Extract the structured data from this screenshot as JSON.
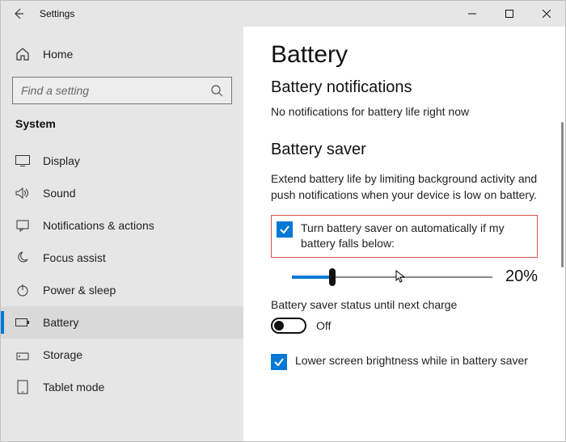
{
  "window": {
    "title": "Settings"
  },
  "sidebar": {
    "home": "Home",
    "search_placeholder": "Find a setting",
    "category": "System",
    "items": [
      {
        "label": "Display",
        "icon": "display-icon"
      },
      {
        "label": "Sound",
        "icon": "sound-icon"
      },
      {
        "label": "Notifications & actions",
        "icon": "notifications-icon"
      },
      {
        "label": "Focus assist",
        "icon": "focus-assist-icon"
      },
      {
        "label": "Power & sleep",
        "icon": "power-icon"
      },
      {
        "label": "Battery",
        "icon": "battery-icon",
        "selected": true
      },
      {
        "label": "Storage",
        "icon": "storage-icon"
      },
      {
        "label": "Tablet mode",
        "icon": "tablet-icon"
      }
    ]
  },
  "content": {
    "page_title": "Battery",
    "section_title": "Battery notifications",
    "empty_notice": "No notifications for battery life right now",
    "saver_title": "Battery saver",
    "saver_desc": "Extend battery life by limiting background activity and push notifications when your device is low on battery.",
    "auto_label": "Turn battery saver on automatically if my battery falls below:",
    "slider_percent": "20%",
    "slider_value": 20,
    "status_label": "Battery saver status until next charge",
    "toggle_state": "Off",
    "brightness_label": "Lower screen brightness while in battery saver"
  }
}
